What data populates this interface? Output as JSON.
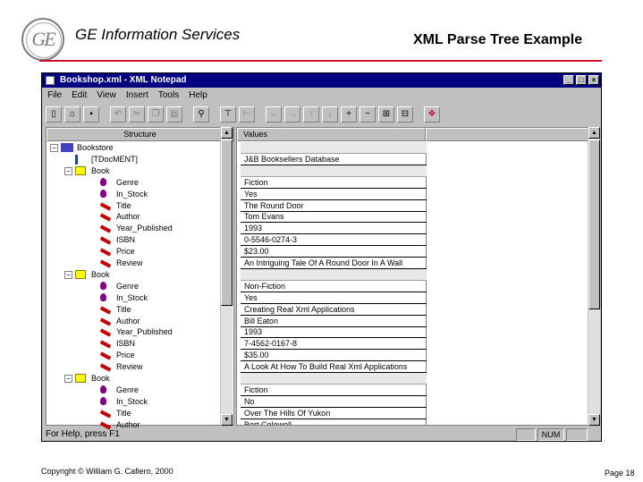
{
  "slide": {
    "company": "GE Information Services",
    "title": "XML Parse Tree Example",
    "logo_text": "GE",
    "copyright": "Copyright © William G. Cafiero, 2000",
    "page": "Page 18",
    "rule_color": "#c8102e"
  },
  "window": {
    "title": "Bookshop.xml - XML Notepad",
    "controls": [
      "_",
      "□",
      "×"
    ],
    "menu": [
      "File",
      "Edit",
      "View",
      "Insert",
      "Tools",
      "Help"
    ],
    "toolbar_icons": [
      "new-icon",
      "open-icon",
      "save-icon",
      "undo-icon",
      "cut-icon",
      "copy-icon",
      "paste-icon",
      "find-icon",
      "insert-element-icon",
      "insert-attribute-icon",
      "move-left-icon",
      "move-right-icon",
      "move-up-icon",
      "move-down-icon",
      "add-icon",
      "remove-icon",
      "expand-icon",
      "collapse-icon",
      "about-icon"
    ],
    "structure_header": "Structure",
    "values_header": "Values",
    "tree": [
      {
        "label": "Bookstore",
        "icon": "document-icon",
        "expander": "−"
      },
      {
        "label": "[TDocMENT]",
        "icon": "pi-icon"
      },
      {
        "label": "Book",
        "icon": "folder-icon",
        "expander": "−"
      },
      {
        "label": "Genre",
        "icon": "attribute-icon"
      },
      {
        "label": "In_Stock",
        "icon": "attribute-icon"
      },
      {
        "label": "Title",
        "icon": "element-icon"
      },
      {
        "label": "Author",
        "icon": "element-icon"
      },
      {
        "label": "Year_Published",
        "icon": "element-icon"
      },
      {
        "label": "ISBN",
        "icon": "element-icon"
      },
      {
        "label": "Price",
        "icon": "element-icon"
      },
      {
        "label": "Review",
        "icon": "element-icon"
      },
      {
        "label": "Book",
        "icon": "folder-icon",
        "expander": "−"
      },
      {
        "label": "Genre",
        "icon": "attribute-icon"
      },
      {
        "label": "In_Stock",
        "icon": "attribute-icon"
      },
      {
        "label": "Title",
        "icon": "element-icon"
      },
      {
        "label": "Author",
        "icon": "element-icon"
      },
      {
        "label": "Year_Published",
        "icon": "element-icon"
      },
      {
        "label": "ISBN",
        "icon": "element-icon"
      },
      {
        "label": "Price",
        "icon": "element-icon"
      },
      {
        "label": "Review",
        "icon": "element-icon"
      },
      {
        "label": "Book",
        "icon": "folder-icon",
        "expander": "−"
      },
      {
        "label": "Genre",
        "icon": "attribute-icon"
      },
      {
        "label": "In_Stock",
        "icon": "attribute-icon"
      },
      {
        "label": "Title",
        "icon": "element-icon"
      },
      {
        "label": "Author",
        "icon": "element-icon"
      }
    ],
    "values": [
      "",
      "J&B Booksellers Database",
      "",
      "Fiction",
      "Yes",
      "The Round Door",
      "Tom Evans",
      "1993",
      "0-5546-0274-3",
      "$23.00",
      "An Intriguing Tale Of A Round Door In A Wall",
      "",
      "Non-Fiction",
      "Yes",
      "Creating Real Xml Applications",
      "Bill Eaton",
      "1993",
      "7-4562-0167-8",
      "$35.00",
      "A Look At How To Build Real Xml Applications",
      "",
      "Fiction",
      "No",
      "Over The Hills Of Yukon",
      "Bert Colewell"
    ],
    "status": "For Help, press F1",
    "status_num": "NUM"
  }
}
